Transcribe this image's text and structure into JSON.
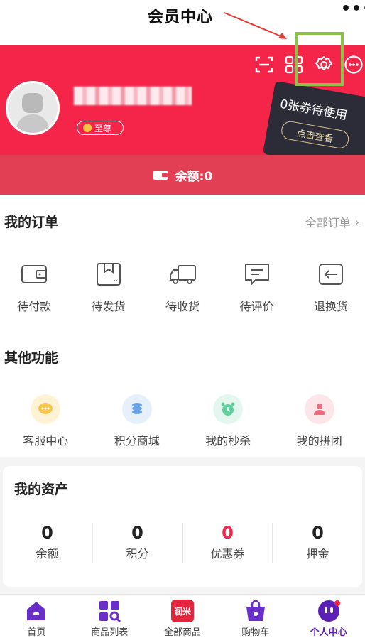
{
  "annotation": {
    "title": "会员中心"
  },
  "top_more": "•••",
  "header": {
    "icons": [
      "scan-icon",
      "qrcode-icon",
      "settings-gear-icon",
      "more-icon"
    ],
    "level_badge": "至尊",
    "coupon": {
      "text": "0张券待使用",
      "button": "点击查看"
    }
  },
  "balance": {
    "label": "余额:0"
  },
  "orders": {
    "title": "我的订单",
    "all_link": "全部订单",
    "items": [
      {
        "label": "待付款",
        "icon": "wallet-icon"
      },
      {
        "label": "待发货",
        "icon": "package-icon"
      },
      {
        "label": "待收货",
        "icon": "truck-icon"
      },
      {
        "label": "待评价",
        "icon": "comment-icon"
      },
      {
        "label": "退换货",
        "icon": "return-icon"
      }
    ]
  },
  "other": {
    "title": "其他功能",
    "items": [
      {
        "label": "客服中心",
        "icon": "customer-service-icon",
        "color": "#f9c74f",
        "bg": "#fff3d6"
      },
      {
        "label": "积分商城",
        "icon": "coins-icon",
        "color": "#6aa3e8",
        "bg": "#e6f0fb"
      },
      {
        "label": "我的秒杀",
        "icon": "alarm-clock-icon",
        "color": "#5fcf9c",
        "bg": "#e3f7ee"
      },
      {
        "label": "我的拼团",
        "icon": "group-icon",
        "color": "#f06a7f",
        "bg": "#fde6ea"
      }
    ]
  },
  "assets": {
    "title": "我的资产",
    "items": [
      {
        "value": "0",
        "label": "余额",
        "red": false
      },
      {
        "value": "0",
        "label": "积分",
        "red": false
      },
      {
        "value": "0",
        "label": "优惠券",
        "red": true
      },
      {
        "value": "0",
        "label": "押金",
        "red": false
      }
    ]
  },
  "nav": {
    "items": [
      {
        "label": "首页",
        "icon": "home-icon"
      },
      {
        "label": "商品列表",
        "icon": "product-list-icon"
      },
      {
        "label": "全部商品",
        "icon": "all-products-icon",
        "badge": "润米"
      },
      {
        "label": "购物车",
        "icon": "cart-icon"
      },
      {
        "label": "个人中心",
        "icon": "profile-icon",
        "active": true
      }
    ]
  },
  "colors": {
    "primary_red": "#f5254a",
    "balance_red": "#e23e54",
    "purple": "#5b21b6",
    "highlight_green": "#8bc34a"
  }
}
